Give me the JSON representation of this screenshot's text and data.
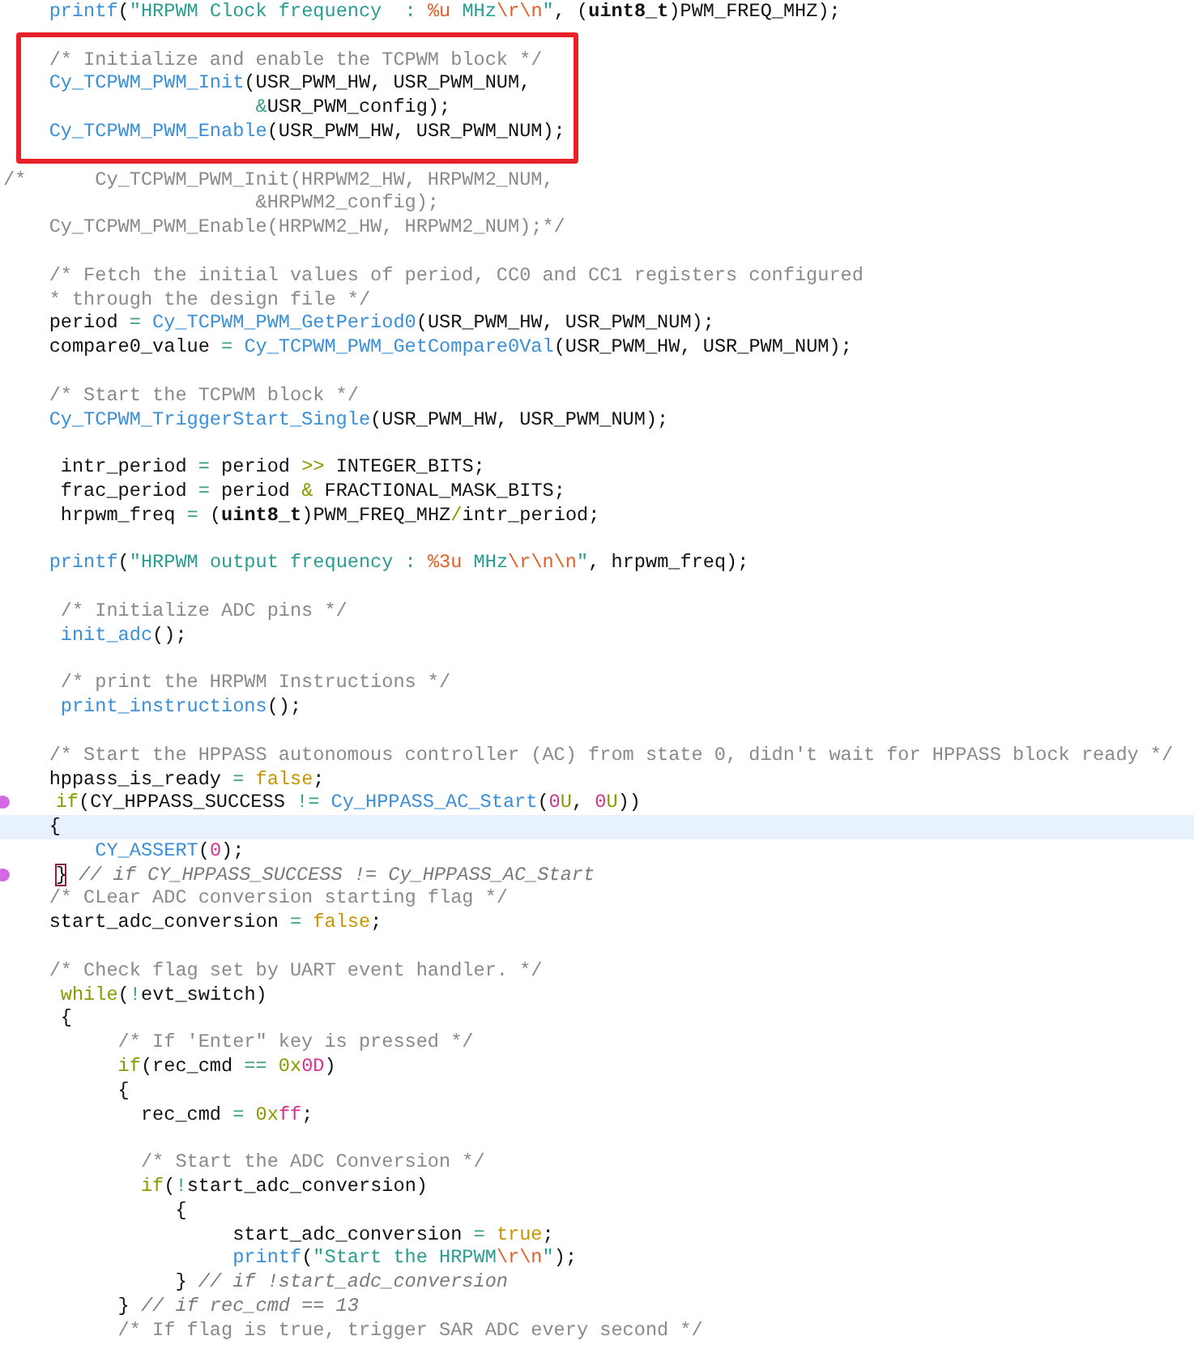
{
  "lines": [
    {
      "kind": "code",
      "tokens": [
        {
          "kind": "fn",
          "text": "    printf"
        },
        {
          "kind": "plain",
          "text": "("
        },
        {
          "kind": "str",
          "text": "\"HRPWM Clock frequency  : "
        },
        {
          "kind": "fmt",
          "text": "%u"
        },
        {
          "kind": "str",
          "text": " MHz"
        },
        {
          "kind": "fmt",
          "text": "\\r\\n"
        },
        {
          "kind": "str",
          "text": "\""
        },
        {
          "kind": "plain",
          "text": ", ("
        },
        {
          "kind": "type",
          "text": "uint8_t"
        },
        {
          "kind": "plain",
          "text": ")PWM_FREQ_MHZ);"
        }
      ]
    },
    {
      "kind": "blank"
    },
    {
      "kind": "code",
      "boxed": true,
      "tokens": [
        {
          "kind": "comment",
          "text": "    /* Initialize and enable the TCPWM block */"
        }
      ]
    },
    {
      "kind": "code",
      "boxed": true,
      "tokens": [
        {
          "kind": "fn",
          "text": "    Cy_TCPWM_PWM_Init"
        },
        {
          "kind": "plain",
          "text": "(USR_PWM_HW, USR_PWM_NUM,"
        }
      ]
    },
    {
      "kind": "code",
      "boxed": true,
      "tokens": [
        {
          "kind": "op",
          "text": "                      &"
        },
        {
          "kind": "plain",
          "text": "USR_PWM_config);"
        }
      ]
    },
    {
      "kind": "code",
      "boxed": true,
      "tokens": [
        {
          "kind": "fn",
          "text": "    Cy_TCPWM_PWM_Enable"
        },
        {
          "kind": "plain",
          "text": "(USR_PWM_HW, USR_PWM_NUM);"
        }
      ]
    },
    {
      "kind": "blank"
    },
    {
      "kind": "code",
      "tokens": [
        {
          "kind": "comment",
          "text": "/*      Cy_TCPWM_PWM_Init(HRPWM2_HW, HRPWM2_NUM,"
        }
      ]
    },
    {
      "kind": "code",
      "tokens": [
        {
          "kind": "comment",
          "text": "                      &HRPWM2_config);"
        }
      ]
    },
    {
      "kind": "code",
      "tokens": [
        {
          "kind": "comment",
          "text": "    Cy_TCPWM_PWM_Enable(HRPWM2_HW, HRPWM2_NUM);*/"
        }
      ]
    },
    {
      "kind": "blank"
    },
    {
      "kind": "code",
      "tokens": [
        {
          "kind": "comment",
          "text": "    /* Fetch the initial values of period, CC0 and CC1 registers configured"
        }
      ]
    },
    {
      "kind": "code",
      "tokens": [
        {
          "kind": "comment",
          "text": "    * through the design file */"
        }
      ]
    },
    {
      "kind": "code",
      "tokens": [
        {
          "kind": "plain",
          "text": "    period "
        },
        {
          "kind": "op",
          "text": "="
        },
        {
          "kind": "fn",
          "text": " Cy_TCPWM_PWM_GetPeriod0"
        },
        {
          "kind": "plain",
          "text": "(USR_PWM_HW, USR_PWM_NUM);"
        }
      ]
    },
    {
      "kind": "code",
      "tokens": [
        {
          "kind": "plain",
          "text": "    compare0_value "
        },
        {
          "kind": "op",
          "text": "="
        },
        {
          "kind": "fn",
          "text": " Cy_TCPWM_PWM_GetCompare0Val"
        },
        {
          "kind": "plain",
          "text": "(USR_PWM_HW, USR_PWM_NUM);"
        }
      ]
    },
    {
      "kind": "blank"
    },
    {
      "kind": "code",
      "tokens": [
        {
          "kind": "comment",
          "text": "    /* Start the TCPWM block */"
        }
      ]
    },
    {
      "kind": "code",
      "tokens": [
        {
          "kind": "fn",
          "text": "    Cy_TCPWM_TriggerStart_Single"
        },
        {
          "kind": "plain",
          "text": "(USR_PWM_HW, USR_PWM_NUM);"
        }
      ]
    },
    {
      "kind": "blank"
    },
    {
      "kind": "code",
      "tokens": [
        {
          "kind": "plain",
          "text": "     intr_period "
        },
        {
          "kind": "op",
          "text": "="
        },
        {
          "kind": "plain",
          "text": " period "
        },
        {
          "kind": "kw",
          "text": ">>"
        },
        {
          "kind": "plain",
          "text": " INTEGER_BITS;"
        }
      ]
    },
    {
      "kind": "code",
      "tokens": [
        {
          "kind": "plain",
          "text": "     frac_period "
        },
        {
          "kind": "op",
          "text": "="
        },
        {
          "kind": "plain",
          "text": " period "
        },
        {
          "kind": "kw",
          "text": "&"
        },
        {
          "kind": "plain",
          "text": " FRACTIONAL_MASK_BITS;"
        }
      ]
    },
    {
      "kind": "code",
      "tokens": [
        {
          "kind": "plain",
          "text": "     hrpwm_freq "
        },
        {
          "kind": "op",
          "text": "="
        },
        {
          "kind": "plain",
          "text": " ("
        },
        {
          "kind": "type",
          "text": "uint8_t"
        },
        {
          "kind": "plain",
          "text": ")PWM_FREQ_MHZ"
        },
        {
          "kind": "kw",
          "text": "/"
        },
        {
          "kind": "plain",
          "text": "intr_period;"
        }
      ]
    },
    {
      "kind": "blank"
    },
    {
      "kind": "code",
      "tokens": [
        {
          "kind": "fn",
          "text": "    printf"
        },
        {
          "kind": "plain",
          "text": "("
        },
        {
          "kind": "str",
          "text": "\"HRPWM output frequency : "
        },
        {
          "kind": "fmt",
          "text": "%3u"
        },
        {
          "kind": "str",
          "text": " MHz"
        },
        {
          "kind": "fmt",
          "text": "\\r\\n\\n"
        },
        {
          "kind": "str",
          "text": "\""
        },
        {
          "kind": "plain",
          "text": ", hrpwm_freq);"
        }
      ]
    },
    {
      "kind": "blank"
    },
    {
      "kind": "code",
      "tokens": [
        {
          "kind": "comment",
          "text": "     /* Initialize ADC pins */"
        }
      ]
    },
    {
      "kind": "code",
      "tokens": [
        {
          "kind": "fn",
          "text": "     init_adc"
        },
        {
          "kind": "plain",
          "text": "();"
        }
      ]
    },
    {
      "kind": "blank"
    },
    {
      "kind": "code",
      "tokens": [
        {
          "kind": "comment",
          "text": "     /* print the HRPWM Instructions */"
        }
      ]
    },
    {
      "kind": "code",
      "tokens": [
        {
          "kind": "fn",
          "text": "     print_instructions"
        },
        {
          "kind": "plain",
          "text": "();"
        }
      ]
    },
    {
      "kind": "blank"
    },
    {
      "kind": "code",
      "tokens": [
        {
          "kind": "comment",
          "text": "    /* Start the HPPASS autonomous controller (AC) from state 0, didn't wait for HPPASS block ready */"
        }
      ]
    },
    {
      "kind": "code",
      "tokens": [
        {
          "kind": "plain",
          "text": "    hppass_is_ready "
        },
        {
          "kind": "op",
          "text": "="
        },
        {
          "kind": "lit",
          "text": " false"
        },
        {
          "kind": "plain",
          "text": ";"
        }
      ]
    },
    {
      "kind": "code",
      "breakpoint": true,
      "tokens": [
        {
          "kind": "kw",
          "text": "    if"
        },
        {
          "kind": "plain",
          "text": "(CY_HPPASS_SUCCESS "
        },
        {
          "kind": "op",
          "text": "!="
        },
        {
          "kind": "fn",
          "text": " Cy_HPPASS_AC_Start"
        },
        {
          "kind": "plain",
          "text": "("
        },
        {
          "kind": "num",
          "text": "0"
        },
        {
          "kind": "kw",
          "text": "U"
        },
        {
          "kind": "plain",
          "text": ", "
        },
        {
          "kind": "num",
          "text": "0"
        },
        {
          "kind": "kw",
          "text": "U"
        },
        {
          "kind": "plain",
          "text": "))"
        }
      ]
    },
    {
      "kind": "code",
      "current": true,
      "tokens": [
        {
          "kind": "plain",
          "text": "    {"
        }
      ]
    },
    {
      "kind": "code",
      "tokens": [
        {
          "kind": "fn",
          "text": "        CY_ASSERT"
        },
        {
          "kind": "plain",
          "text": "("
        },
        {
          "kind": "num",
          "text": "0"
        },
        {
          "kind": "plain",
          "text": ");"
        }
      ]
    },
    {
      "kind": "code",
      "breakpoint": true,
      "tokens": [
        {
          "kind": "bracket",
          "text": "    }"
        },
        {
          "kind": "italic",
          "text": " // if CY_HPPASS_SUCCESS != Cy_HPPASS_AC_Start"
        }
      ]
    },
    {
      "kind": "code",
      "tokens": [
        {
          "kind": "comment",
          "text": "    /* CLear ADC conversion starting flag */"
        }
      ]
    },
    {
      "kind": "code",
      "tokens": [
        {
          "kind": "plain",
          "text": "    start_adc_conversion "
        },
        {
          "kind": "op",
          "text": "="
        },
        {
          "kind": "lit",
          "text": " false"
        },
        {
          "kind": "plain",
          "text": ";"
        }
      ]
    },
    {
      "kind": "blank"
    },
    {
      "kind": "code",
      "tokens": [
        {
          "kind": "comment",
          "text": "    /* Check flag set by UART event handler. */"
        }
      ]
    },
    {
      "kind": "code",
      "tokens": [
        {
          "kind": "kw",
          "text": "     while"
        },
        {
          "kind": "plain",
          "text": "("
        },
        {
          "kind": "op",
          "text": "!"
        },
        {
          "kind": "plain",
          "text": "evt_switch)"
        }
      ]
    },
    {
      "kind": "code",
      "tokens": [
        {
          "kind": "plain",
          "text": "     {"
        }
      ]
    },
    {
      "kind": "code",
      "tokens": [
        {
          "kind": "comment",
          "text": "          /* If 'Enter\" key is pressed */"
        }
      ]
    },
    {
      "kind": "code",
      "tokens": [
        {
          "kind": "kw",
          "text": "          if"
        },
        {
          "kind": "plain",
          "text": "(rec_cmd "
        },
        {
          "kind": "op",
          "text": "=="
        },
        {
          "kind": "kw",
          "text": " 0x"
        },
        {
          "kind": "num",
          "text": "0D"
        },
        {
          "kind": "plain",
          "text": ")"
        }
      ]
    },
    {
      "kind": "code",
      "tokens": [
        {
          "kind": "plain",
          "text": "          {"
        }
      ]
    },
    {
      "kind": "code",
      "tokens": [
        {
          "kind": "plain",
          "text": "            rec_cmd "
        },
        {
          "kind": "op",
          "text": "="
        },
        {
          "kind": "kw",
          "text": " 0x"
        },
        {
          "kind": "num",
          "text": "ff"
        },
        {
          "kind": "plain",
          "text": ";"
        }
      ]
    },
    {
      "kind": "blank"
    },
    {
      "kind": "code",
      "tokens": [
        {
          "kind": "comment",
          "text": "            /* Start the ADC Conversion */"
        }
      ]
    },
    {
      "kind": "code",
      "tokens": [
        {
          "kind": "kw",
          "text": "            if"
        },
        {
          "kind": "plain",
          "text": "("
        },
        {
          "kind": "op",
          "text": "!"
        },
        {
          "kind": "plain",
          "text": "start_adc_conversion)"
        }
      ]
    },
    {
      "kind": "code",
      "tokens": [
        {
          "kind": "plain",
          "text": "               {"
        }
      ]
    },
    {
      "kind": "code",
      "tokens": [
        {
          "kind": "plain",
          "text": "                    start_adc_conversion "
        },
        {
          "kind": "op",
          "text": "="
        },
        {
          "kind": "lit",
          "text": " true"
        },
        {
          "kind": "plain",
          "text": ";"
        }
      ]
    },
    {
      "kind": "code",
      "tokens": [
        {
          "kind": "fn",
          "text": "                    printf"
        },
        {
          "kind": "plain",
          "text": "("
        },
        {
          "kind": "str",
          "text": "\"Start the HRPWM"
        },
        {
          "kind": "fmt",
          "text": "\\r\\n"
        },
        {
          "kind": "str",
          "text": "\""
        },
        {
          "kind": "plain",
          "text": ");"
        }
      ]
    },
    {
      "kind": "code",
      "tokens": [
        {
          "kind": "plain",
          "text": "               }"
        },
        {
          "kind": "italic",
          "text": " // if !start_adc_conversion"
        }
      ]
    },
    {
      "kind": "code",
      "tokens": [
        {
          "kind": "plain",
          "text": "          }"
        },
        {
          "kind": "italic",
          "text": " // if rec_cmd == 13"
        }
      ]
    },
    {
      "kind": "code",
      "tokens": [
        {
          "kind": "comment",
          "text": "          /* If flag is true, trigger SAR ADC every second */"
        }
      ]
    }
  ]
}
